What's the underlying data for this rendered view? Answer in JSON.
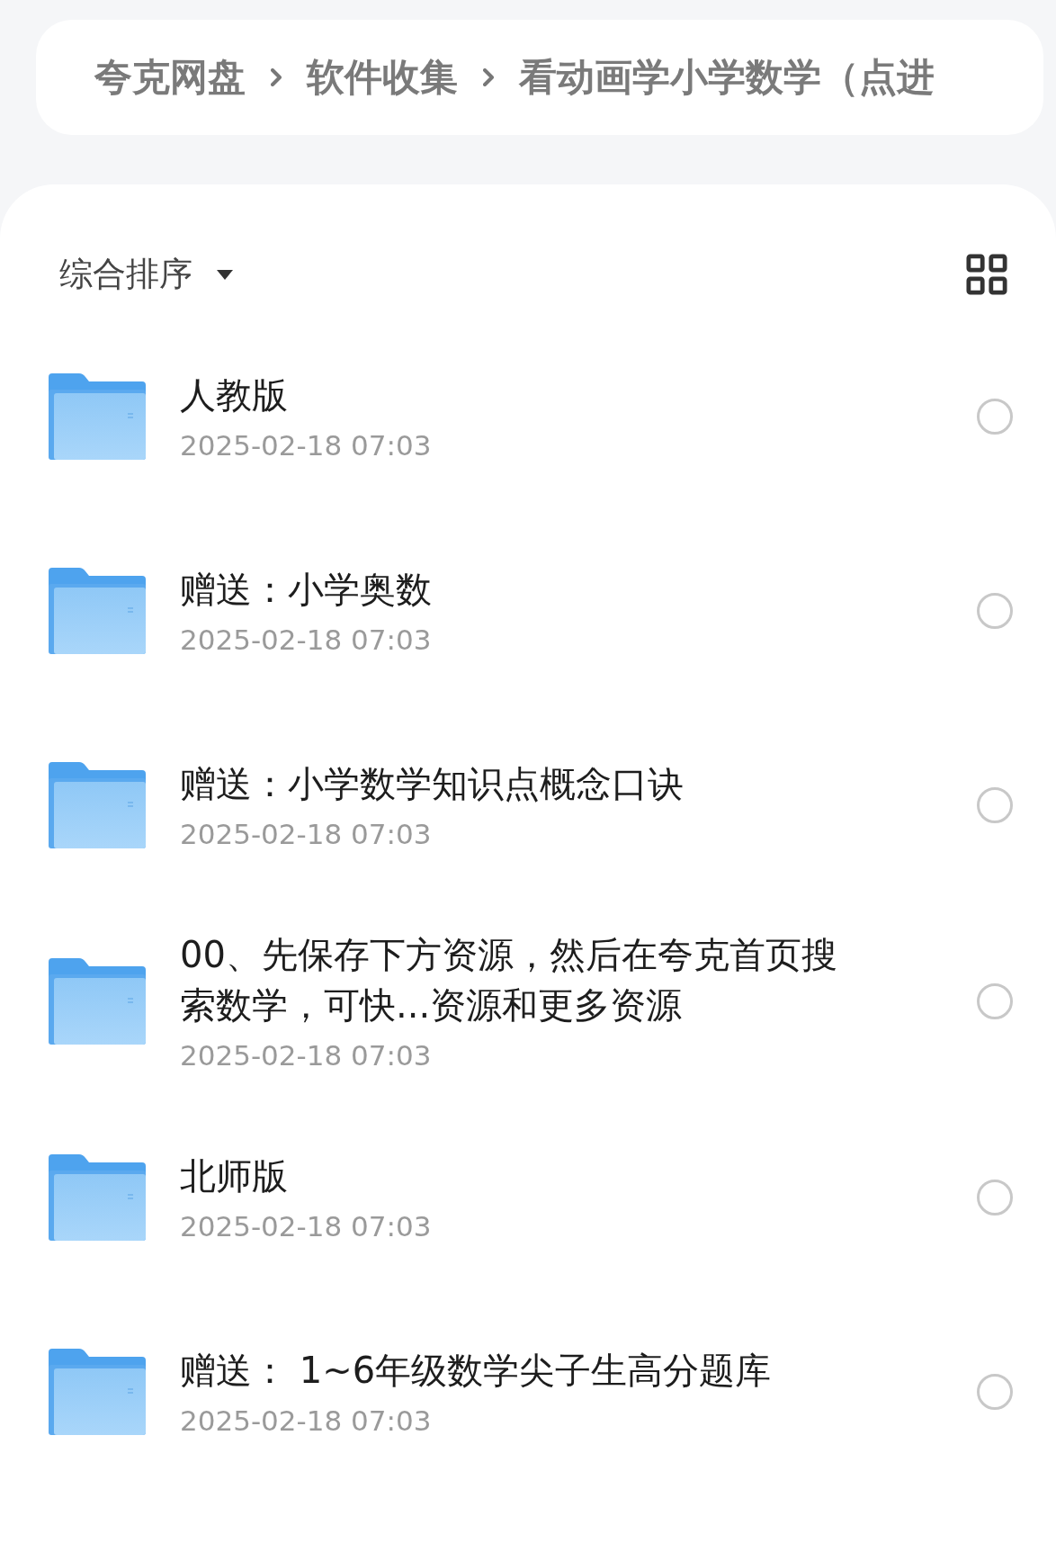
{
  "breadcrumb": [
    {
      "label": "夸克网盘"
    },
    {
      "label": "软件收集"
    },
    {
      "label": "看动画学小学数学（点进"
    }
  ],
  "sort": {
    "label": "综合排序"
  },
  "files": [
    {
      "name": "人教版",
      "date": "2025-02-18 07:03",
      "selected": false
    },
    {
      "name": "赠送：小学奥数",
      "date": "2025-02-18 07:03",
      "selected": false
    },
    {
      "name": "赠送：小学数学知识点概念口诀",
      "date": "2025-02-18 07:03",
      "selected": false
    },
    {
      "name": "00、先保存下方资源，然后在夸克首页搜索数学，可快...资源和更多资源",
      "date": "2025-02-18 07:03",
      "selected": false
    },
    {
      "name": "北师版",
      "date": "2025-02-18 07:03",
      "selected": false
    },
    {
      "name": "赠送： 1~6年级数学尖子生高分题库",
      "date": "2025-02-18 07:03",
      "selected": false
    }
  ]
}
